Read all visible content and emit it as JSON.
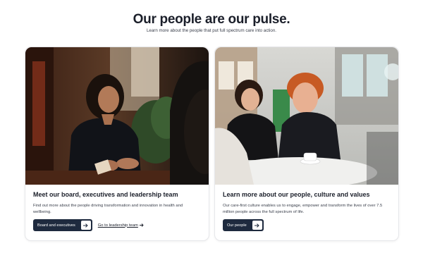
{
  "header": {
    "title": "Our people are our pulse.",
    "subtitle": "Learn more about the people that put full spectrum care into action."
  },
  "cards": [
    {
      "title": "Meet our board, executives and leadership team",
      "description": "Find out more about the people driving transformation and innovation in health and wellbeing.",
      "primary_button": "Board and executives",
      "secondary_link": "Go to leadership team"
    },
    {
      "title": "Learn more about our people, culture and values",
      "description": "Our care-first culture enables us to engage, empower and transform the lives of over 7.5 million people across the full spectrum of life.",
      "primary_button": "Our people"
    }
  ],
  "icons": {
    "button_arrow": "arrow-right-icon",
    "link_arrow": "arrow-right-icon"
  },
  "colors": {
    "heading": "#1b1f2a",
    "button_bg": "#1e2a3e",
    "button_text": "#ffffff"
  }
}
